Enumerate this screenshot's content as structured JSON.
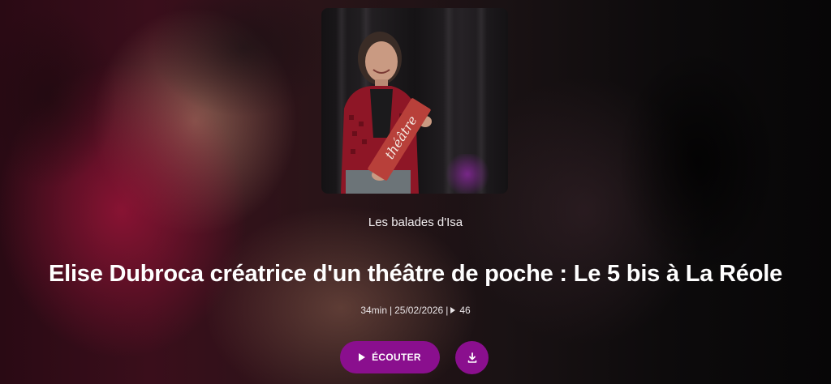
{
  "podcast": {
    "name": "Les balades d'Isa"
  },
  "episode": {
    "title": "Elise Dubroca créatrice d'un théâtre de poche : Le 5 bis à La Réole",
    "duration": "34min",
    "date": "25/02/2026",
    "plays": "46"
  },
  "cover": {
    "sign_text": "théâtre"
  },
  "actions": {
    "listen_label": "ÉCOUTER",
    "listen_icon": "play-icon",
    "download_icon": "download-icon"
  },
  "colors": {
    "accent": "#8a0f8e",
    "text": "#ffffff"
  }
}
